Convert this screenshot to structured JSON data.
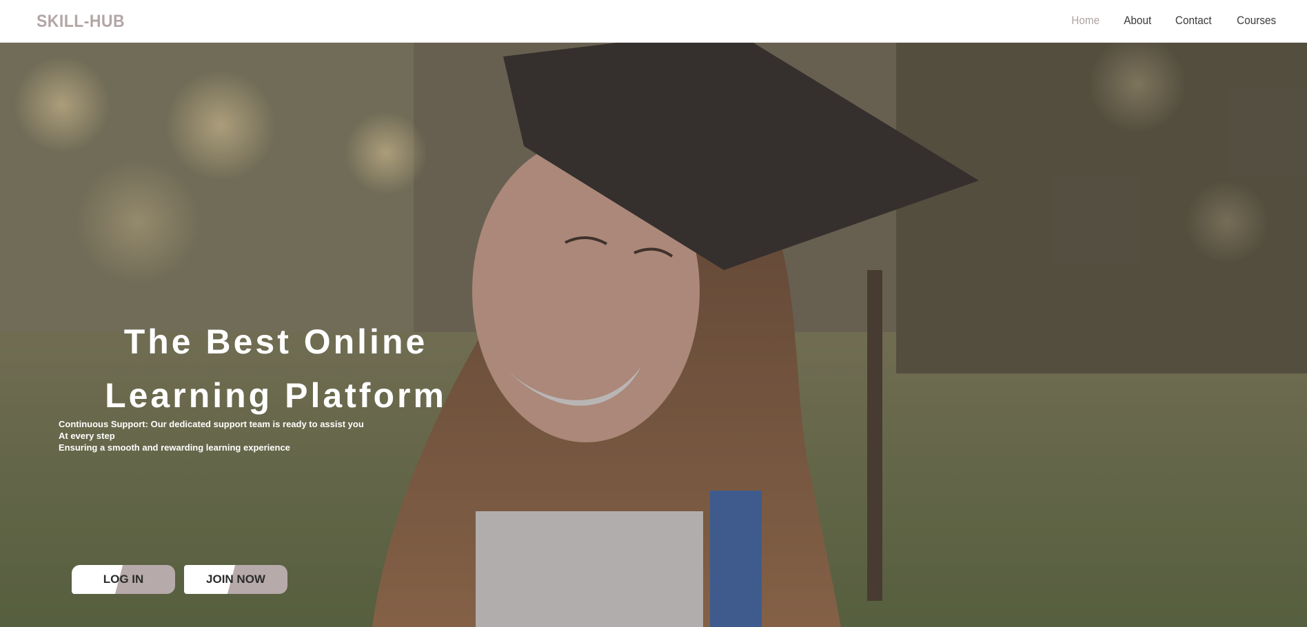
{
  "nav": {
    "logo": "SKILL-HUB",
    "links": [
      {
        "label": "Home",
        "active": true
      },
      {
        "label": "About",
        "active": false
      },
      {
        "label": "Contact",
        "active": false
      },
      {
        "label": "Courses",
        "active": false
      }
    ]
  },
  "hero": {
    "title": "The Best Online Learning Platform",
    "lines": [
      "Continuous Support: Our dedicated support team is ready to assist you",
      "At every step",
      "Ensuring a smooth and rewarding learning experience"
    ],
    "buttons": {
      "login": "LOG IN",
      "join": "JOIN NOW"
    },
    "background_image": "graduate-photo"
  },
  "colors": {
    "accent": "#b7aaaa",
    "nav_active": "#b0a3a3",
    "nav_text": "#3a3a3a",
    "hero_text": "#ffffff"
  }
}
